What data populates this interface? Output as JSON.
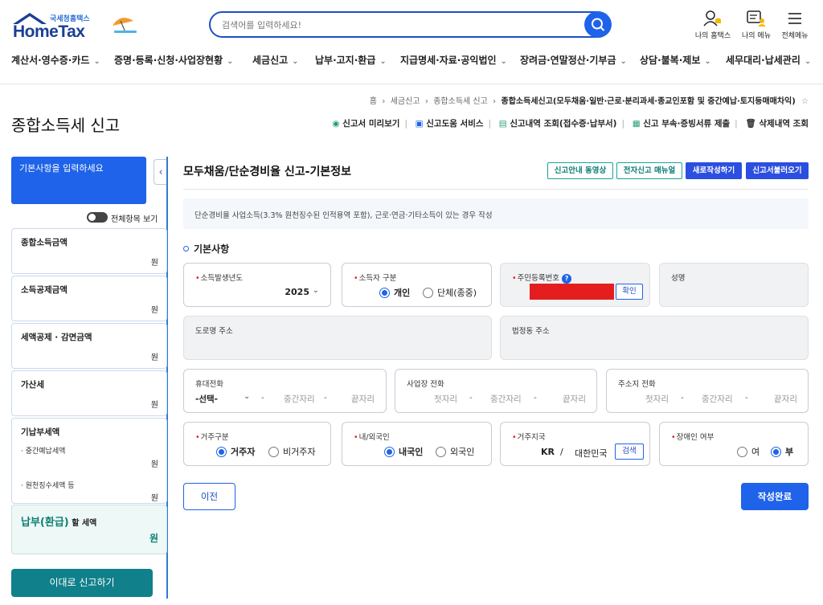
{
  "header": {
    "brand_sub": "국세청홈택스",
    "brand": "HomeTax",
    "search_placeholder": "검색어를 입력하세요!",
    "my_hometax": "나의 홈택스",
    "my_menu": "나의 메뉴",
    "all_menu": "전체메뉴"
  },
  "menu": [
    {
      "label": "계산서·영수증·카드"
    },
    {
      "label": "증명·등록·신청·사업장현황"
    },
    {
      "label": "세금신고"
    },
    {
      "label": "납부·고지·환급"
    },
    {
      "label": "지급명세·자료·공익법인"
    },
    {
      "label": "장려금·연말정산·기부금"
    },
    {
      "label": "상담·불복·제보"
    },
    {
      "label": "세무대리·납세관리"
    }
  ],
  "breadcrumb": {
    "home": "홈",
    "l1": "세금신고",
    "l2": "종합소득세 신고",
    "current": "종합소득세신고(모두채움·일반·근로·분리과세·종교인포함 및 중간예납·토지등매매차익)"
  },
  "page_title": "종합소득세 신고",
  "services": {
    "preview": "신고서 미리보기",
    "help": "신고도움 서비스",
    "history": "신고내역 조회(접수증·납부서)",
    "attach": "신고 부속·증빙서류 제출",
    "deleted": "삭제내역 조회"
  },
  "sidebar": {
    "top_label": "기본사항을 입력하세요",
    "toggle_label": "전체항목 보기",
    "won": "원",
    "items": [
      {
        "title": "종합소득금액"
      },
      {
        "title": "소득공제금액"
      },
      {
        "title": "세액공제 · 감면금액"
      },
      {
        "title": "가산세"
      },
      {
        "title": "기납부세액",
        "sub1": "· 중간예납세액",
        "sub2": "· 원천징수세액 등"
      }
    ],
    "pay_title_main": "납부(환급)",
    "pay_title_sub": " 할 세액",
    "file_button": "이대로 신고하기"
  },
  "main": {
    "title": "모두채움/단순경비율 신고-기본정보",
    "btn_video": "신고안내 동영상",
    "btn_manual": "전자신고 매뉴얼",
    "btn_new": "새로작성하기",
    "btn_load": "신고서불러오기",
    "notice": "단순경비율 사업소득(3.3% 원천징수된 인적용역 포함), 근로·연금·기타소득이 있는 경우 작성",
    "section": "기본사항",
    "year_label": "소득발생년도",
    "year_value": "2025",
    "type_label": "소득자 구분",
    "type_opt1": "개인",
    "type_opt2": "단체(종중)",
    "rrn_label": "주민등록번호",
    "rrn_confirm": "확인",
    "name_label": "성명",
    "road_addr_label": "도로명 주소",
    "lot_addr_label": "법정동 주소",
    "mobile_label": "휴대전화",
    "mobile_select": "-선택-",
    "biz_phone_label": "사업장 전화",
    "home_phone_label": "주소지 전화",
    "ph_first": "첫자리",
    "ph_middle": "중간자리",
    "ph_last": "끝자리",
    "residence_label": "거주구분",
    "res_opt1": "거주자",
    "res_opt2": "비거주자",
    "nationality_label": "내/외국인",
    "nat_opt1": "내국인",
    "nat_opt2": "외국인",
    "country_label": "거주지국",
    "country_code": "KR",
    "country_sep": "/",
    "country_name": "대한민국",
    "search_btn": "검색",
    "disabled_label": "장애인 여부",
    "dis_opt1": "여",
    "dis_opt2": "부",
    "prev_btn": "이전",
    "done_btn": "작성완료"
  },
  "colors": {
    "primary": "#1e63e9",
    "teal": "#10808a",
    "redact": "#e41e1e"
  }
}
